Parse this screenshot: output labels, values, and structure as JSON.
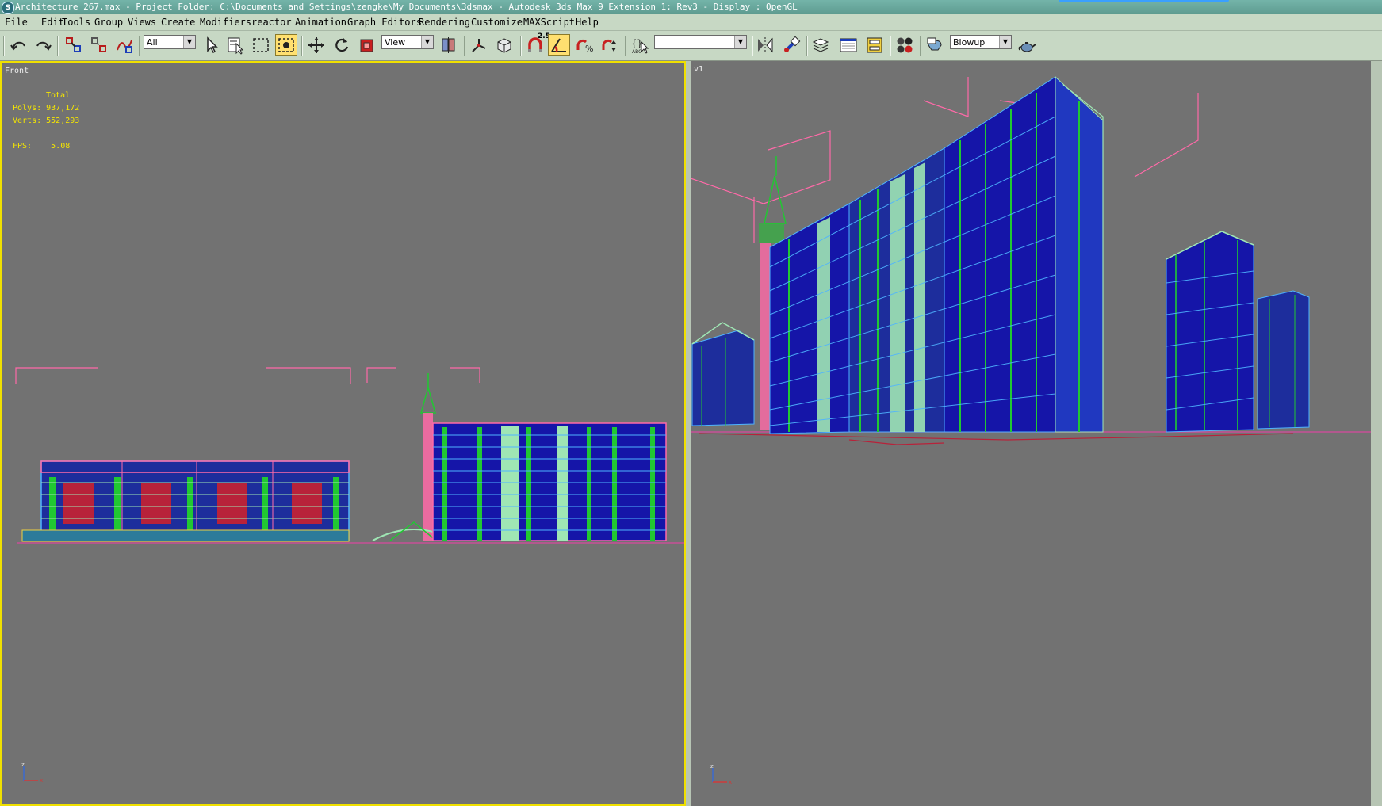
{
  "window": {
    "title": "Architecture 267.max     - Project Folder: C:\\Documents and Settings\\zengke\\My Documents\\3dsmax     - Autodesk 3ds Max 9 Extension 1: Rev3         - Display : OpenGL",
    "icon": "3ds-max-logo-icon"
  },
  "menu": [
    "File",
    "Edit",
    "Tools",
    "Group",
    "Views",
    "Create",
    "Modifiers",
    "reactor",
    "Animation",
    "Graph Editors",
    "Rendering",
    "Customize",
    "MAXScript",
    "Help"
  ],
  "toolbar": {
    "selection_filter": "All",
    "reference_coord": "View",
    "snap_angle": "2.5",
    "named_selection": "",
    "render_type": "Blowup",
    "colors": {
      "active_toggle": "#ffe070"
    }
  },
  "viewports": {
    "front": {
      "label": "Front",
      "stats": {
        "heading": "Total",
        "polys": "Polys: 937,172",
        "verts": "Verts: 552,293",
        "fps": "FPS:    5.08"
      },
      "axis_z": "z",
      "axis_x": "x",
      "active": true
    },
    "perspective": {
      "label": "v1",
      "axis_z": "z",
      "axis_x": "x"
    }
  },
  "colors": {
    "viewport_bg": "#727272",
    "active_border": "#f0e000",
    "stats_text": "#f5e600",
    "wire_blue": "#1515a8",
    "wire_green": "#21c832",
    "wire_mint": "#9fe6b4",
    "wire_pink": "#ff6aa8",
    "wire_cyan": "#4fb4ff",
    "wire_red": "#b8223a"
  }
}
